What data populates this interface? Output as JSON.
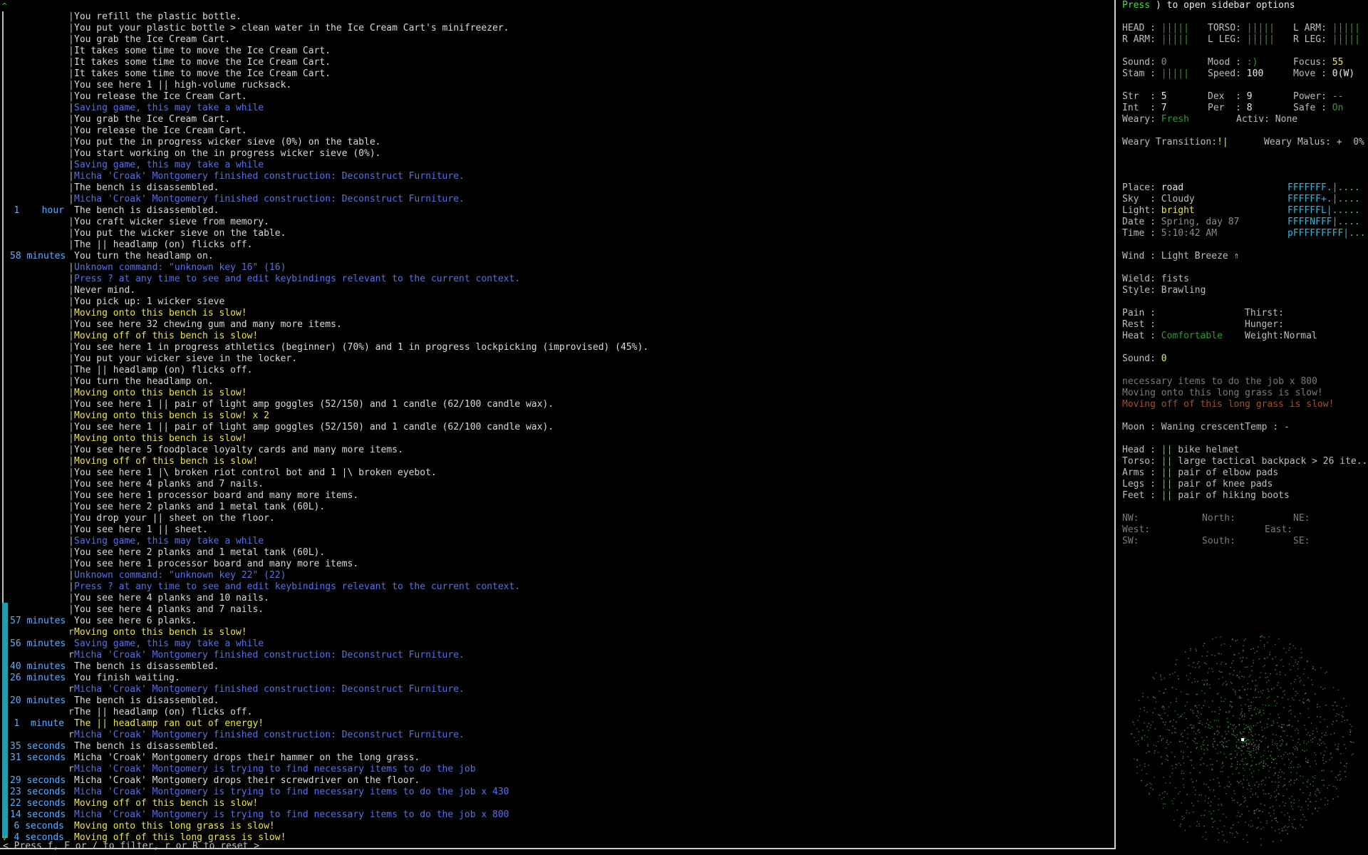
{
  "log": {
    "scroll_up": "^",
    "scroll_down": "v",
    "filter_hint": "< Press f, F or / to filter, r or R to reset >",
    "lines": [
      {
        "time": "",
        "br": "|",
        "color": "white",
        "text": "You refill the plastic bottle."
      },
      {
        "time": "",
        "br": "|",
        "color": "white",
        "text": "You put your plastic bottle > clean water in the Ice Cream Cart's minifreezer."
      },
      {
        "time": "",
        "br": "|",
        "color": "white",
        "text": "You grab the Ice Cream Cart."
      },
      {
        "time": "",
        "br": "|",
        "color": "white",
        "text": "It takes some time to move the Ice Cream Cart."
      },
      {
        "time": "",
        "br": "|",
        "color": "white",
        "text": "It takes some time to move the Ice Cream Cart."
      },
      {
        "time": "",
        "br": "|",
        "color": "white",
        "text": "It takes some time to move the Ice Cream Cart."
      },
      {
        "time": "",
        "br": "|",
        "color": "white",
        "text": "You see here 1 || high-volume rucksack."
      },
      {
        "time": "",
        "br": "|",
        "color": "white",
        "text": "You release the Ice Cream Cart."
      },
      {
        "time": "",
        "br": "|",
        "color": "blue",
        "text": "Saving game, this may take a while"
      },
      {
        "time": "",
        "br": "|",
        "color": "white",
        "text": "You grab the Ice Cream Cart."
      },
      {
        "time": "",
        "br": "|",
        "color": "white",
        "text": "You release the Ice Cream Cart."
      },
      {
        "time": "",
        "br": "|",
        "color": "white",
        "text": "You put the in progress wicker sieve (0%) on the table."
      },
      {
        "time": "",
        "br": "|",
        "color": "white",
        "text": "You start working on the in progress wicker sieve (0%)."
      },
      {
        "time": "",
        "br": "|",
        "color": "blue",
        "text": "Saving game, this may take a while"
      },
      {
        "time": "",
        "br": "|",
        "color": "blue",
        "text": "Micha 'Croak' Montgomery finished construction: Deconstruct Furniture."
      },
      {
        "time": "",
        "br": "|",
        "color": "white",
        "text": "The bench is disassembled."
      },
      {
        "time": "",
        "br": "|",
        "color": "blue",
        "text": "Micha 'Croak' Montgomery finished construction: Deconstruct Furniture."
      },
      {
        "time": "1    hour",
        "br": "",
        "color": "white",
        "text": "The bench is disassembled."
      },
      {
        "time": "",
        "br": "|",
        "color": "white",
        "text": "You craft wicker sieve from memory."
      },
      {
        "time": "",
        "br": "|",
        "color": "white",
        "text": "You put the wicker sieve on the table."
      },
      {
        "time": "",
        "br": "|",
        "color": "white",
        "text": "The || headlamp (on) flicks off."
      },
      {
        "time": "58 minutes",
        "br": "",
        "color": "white",
        "text": "You turn the headlamp on."
      },
      {
        "time": "",
        "br": "|",
        "color": "blue",
        "text": "Unknown command: \"unknown key 16\" (16)"
      },
      {
        "time": "",
        "br": "|",
        "color": "blue",
        "text": "Press ? at any time to see and edit keybindings relevant to the current context."
      },
      {
        "time": "",
        "br": "|",
        "color": "white",
        "text": "Never mind."
      },
      {
        "time": "",
        "br": "|",
        "color": "white",
        "text": "You pick up: 1 wicker sieve"
      },
      {
        "time": "",
        "br": "|",
        "color": "yellow",
        "text": "Moving onto this bench is slow!"
      },
      {
        "time": "",
        "br": "|",
        "color": "white",
        "text": "You see here 32 chewing gum and many more items."
      },
      {
        "time": "",
        "br": "|",
        "color": "yellow",
        "text": "Moving off of this bench is slow!"
      },
      {
        "time": "",
        "br": "|",
        "color": "white",
        "text": "You see here 1 in progress athletics (beginner) (70%) and 1 in progress lockpicking (improvised) (45%)."
      },
      {
        "time": "",
        "br": "|",
        "color": "white",
        "text": "You put your wicker sieve in the locker."
      },
      {
        "time": "",
        "br": "|",
        "color": "white",
        "text": "The || headlamp (on) flicks off."
      },
      {
        "time": "",
        "br": "|",
        "color": "white",
        "text": "You turn the headlamp on."
      },
      {
        "time": "",
        "br": "|",
        "color": "yellow",
        "text": "Moving onto this bench is slow!"
      },
      {
        "time": "",
        "br": "|",
        "color": "white",
        "text": "You see here 1 || pair of light amp goggles (52/150) and 1 candle (62/100 candle wax)."
      },
      {
        "time": "",
        "br": "|",
        "color": "yellow",
        "text": "Moving onto this bench is slow! x 2"
      },
      {
        "time": "",
        "br": "|",
        "color": "white",
        "text": "You see here 1 || pair of light amp goggles (52/150) and 1 candle (62/100 candle wax)."
      },
      {
        "time": "",
        "br": "|",
        "color": "yellow",
        "text": "Moving onto this bench is slow!"
      },
      {
        "time": "",
        "br": "|",
        "color": "white",
        "text": "You see here 5 foodplace loyalty cards and many more items."
      },
      {
        "time": "",
        "br": "|",
        "color": "yellow",
        "text": "Moving off of this bench is slow!"
      },
      {
        "time": "",
        "br": "|",
        "color": "white",
        "text": "You see here 1 |\\ broken riot control bot and 1 |\\ broken eyebot."
      },
      {
        "time": "",
        "br": "|",
        "color": "white",
        "text": "You see here 4 planks and 7 nails."
      },
      {
        "time": "",
        "br": "|",
        "color": "white",
        "text": "You see here 1 processor board and many more items."
      },
      {
        "time": "",
        "br": "|",
        "color": "white",
        "text": "You see here 2 planks and 1 metal tank (60L)."
      },
      {
        "time": "",
        "br": "|",
        "color": "white",
        "text": "You drop your || sheet on the floor."
      },
      {
        "time": "",
        "br": "|",
        "color": "white",
        "text": "You see here 1 || sheet."
      },
      {
        "time": "",
        "br": "|",
        "color": "blue",
        "text": "Saving game, this may take a while"
      },
      {
        "time": "",
        "br": "|",
        "color": "white",
        "text": "You see here 2 planks and 1 metal tank (60L)."
      },
      {
        "time": "",
        "br": "|",
        "color": "white",
        "text": "You see here 1 processor board and many more items."
      },
      {
        "time": "",
        "br": "|",
        "color": "blue",
        "text": "Unknown command: \"unknown key 22\" (22)"
      },
      {
        "time": "",
        "br": "|",
        "color": "blue",
        "text": "Press ? at any time to see and edit keybindings relevant to the current context."
      },
      {
        "time": "",
        "br": "|",
        "color": "white",
        "text": "You see here 4 planks and 10 nails."
      },
      {
        "time": "",
        "br": "|",
        "color": "white",
        "text": "You see here 4 planks and 7 nails."
      },
      {
        "time": "57 minutes",
        "br": "",
        "color": "white",
        "text": "You see here 6 planks."
      },
      {
        "time": "",
        "br": "r",
        "color": "yellow",
        "text": "Moving onto this bench is slow!"
      },
      {
        "time": "56 minutes",
        "br": "",
        "color": "blue",
        "text": "Saving game, this may take a while"
      },
      {
        "time": "",
        "br": "r",
        "color": "blue",
        "text": "Micha 'Croak' Montgomery finished construction: Deconstruct Furniture."
      },
      {
        "time": "40 minutes",
        "br": "",
        "color": "white",
        "text": "The bench is disassembled."
      },
      {
        "time": "26 minutes",
        "br": "",
        "color": "white",
        "text": "You finish waiting."
      },
      {
        "time": "",
        "br": "r",
        "color": "blue",
        "text": "Micha 'Croak' Montgomery finished construction: Deconstruct Furniture."
      },
      {
        "time": "20 minutes",
        "br": "",
        "color": "white",
        "text": "The bench is disassembled."
      },
      {
        "time": "",
        "br": "r",
        "color": "white",
        "text": "The || headlamp (on) flicks off."
      },
      {
        "time": "1  minute",
        "br": "",
        "color": "yellow",
        "text": "The || headlamp ran out of energy!"
      },
      {
        "time": "",
        "br": "r",
        "color": "blue",
        "text": "Micha 'Croak' Montgomery finished construction: Deconstruct Furniture."
      },
      {
        "time": "35 seconds",
        "br": "",
        "color": "white",
        "text": "The bench is disassembled."
      },
      {
        "time": "31 seconds",
        "br": "",
        "color": "white",
        "text": "Micha 'Croak' Montgomery drops their hammer on the long grass."
      },
      {
        "time": "",
        "br": "r",
        "color": "blue",
        "text": "Micha 'Croak' Montgomery is trying to find necessary items to do the job"
      },
      {
        "time": "29 seconds",
        "br": "",
        "color": "white",
        "text": "Micha 'Croak' Montgomery drops their screwdriver on the floor."
      },
      {
        "time": "23 seconds",
        "br": "",
        "color": "blue",
        "text": "Micha 'Croak' Montgomery is trying to find necessary items to do the job x 430"
      },
      {
        "time": "22 seconds",
        "br": "",
        "color": "yellow",
        "text": "Moving off of this bench is slow!"
      },
      {
        "time": "14 seconds",
        "br": "",
        "color": "blue",
        "text": "Micha 'Croak' Montgomery is trying to find necessary items to do the job x 800"
      },
      {
        "time": "6 seconds",
        "br": "",
        "color": "yellow",
        "text": "Moving onto this long grass is slow!"
      },
      {
        "time": "4 seconds",
        "br": "",
        "color": "yellow",
        "text": "Moving off of this long grass is slow!"
      }
    ]
  },
  "sidebar": {
    "press": "Press",
    "press_key": ")",
    "press_rest": " to open sidebar options",
    "body": {
      "head_lbl": "HEAD :",
      "head_val": "|||||",
      "torso_lbl": "TORSO:",
      "torso_val": "|||||",
      "larm_lbl": "L ARM:",
      "larm_val": "|||||",
      "rarm_lbl": "R ARM:",
      "rarm_val": "|||||",
      "lleg_lbl": "L LEG:",
      "lleg_val": "|||||",
      "rleg_lbl": "R LEG:",
      "rleg_val": "|||||"
    },
    "stats": {
      "sound_lbl": "Sound:",
      "sound_val": "0",
      "mood_lbl": "Mood :",
      "mood_val": ":)",
      "focus_lbl": "Focus:",
      "focus_val": "55",
      "stam_lbl": "Stam :",
      "stam_val": "|||||",
      "speed_lbl": "Speed:",
      "speed_val": "100",
      "move_lbl": "Move :",
      "move_val": "0(W)",
      "str_lbl": "Str  :",
      "str_val": "5",
      "dex_lbl": "Dex  :",
      "dex_val": "9",
      "power_lbl": "Power:",
      "power_val": "--",
      "int_lbl": "Int  :",
      "int_val": "7",
      "per_lbl": "Per  :",
      "per_val": "8",
      "safe_lbl": "Safe :",
      "safe_val": "On",
      "weary_lbl": "Weary:",
      "weary_val": "Fresh",
      "activ_lbl": "Activ:",
      "activ_val": "None",
      "wtrans_lbl": "Weary Transition:",
      "wtrans_val": "!|",
      "wmalus_lbl": "Weary Malus:",
      "wmalus_val": "+  0%"
    },
    "location": {
      "place_lbl": "Place:",
      "place_val": "road",
      "sky_lbl": "Sky  :",
      "sky_val": "Cloudy",
      "light_lbl": "Light:",
      "light_val": "bright",
      "date_lbl": "Date :",
      "date_val": "Spring, day 87",
      "time_lbl": "Time :",
      "time_val": "5:10:42 AM"
    },
    "minimap_rows": [
      "FFFFFFF.|....",
      "FFFFFF+.|....",
      "FFFFFFL|.....",
      "FFFFNFFF|....",
      "pFFFFFFFFF|..."
    ],
    "wind_lbl": "Wind :",
    "wind_val": "Light Breeze ⇑",
    "wield_lbl": "Wield:",
    "wield_val": "fists",
    "style_lbl": "Style:",
    "style_val": "Brawling",
    "needs": {
      "pain_lbl": "Pain :",
      "thirst_lbl": "Thirst:",
      "rest_lbl": "Rest :",
      "hunger_lbl": "Hunger:",
      "heat_lbl": "Heat :",
      "heat_val": "Comfortable",
      "weight_lbl": "Weight:",
      "weight_val": "Normal"
    },
    "sound2_lbl": "Sound:",
    "sound2_val": "0",
    "recent": [
      "necessary items to do the job x 800",
      "Moving onto this long grass is slow!",
      "Moving off of this long grass is slow!"
    ],
    "moon_lbl": "Moon :",
    "moon_val": "Waning crescent",
    "temp_lbl": "Temp :",
    "temp_val": "-",
    "wear": {
      "head_lbl": "Head :",
      "head_val": "bike helmet",
      "torso_lbl": "Torso:",
      "torso_val": "large tactical backpack > 26 ite...",
      "arms_lbl": "Arms :",
      "arms_val": "pair of elbow pads",
      "legs_lbl": "Legs :",
      "legs_val": "pair of knee pads",
      "feet_lbl": "Feet :",
      "feet_val": "pair of hiking boots",
      "bar": "||"
    },
    "compass": {
      "nw": "NW:",
      "north": "North:",
      "ne": "NE:",
      "west": "West:",
      "east": "East:",
      "sw": "SW:",
      "south": "South:",
      "se": "SE:"
    },
    "colors": {
      "accent_green": "#44dd44",
      "accent_cyan": "#1a9fb3",
      "log_blue": "#5b6fe0",
      "log_yellow": "#e8e840"
    }
  }
}
